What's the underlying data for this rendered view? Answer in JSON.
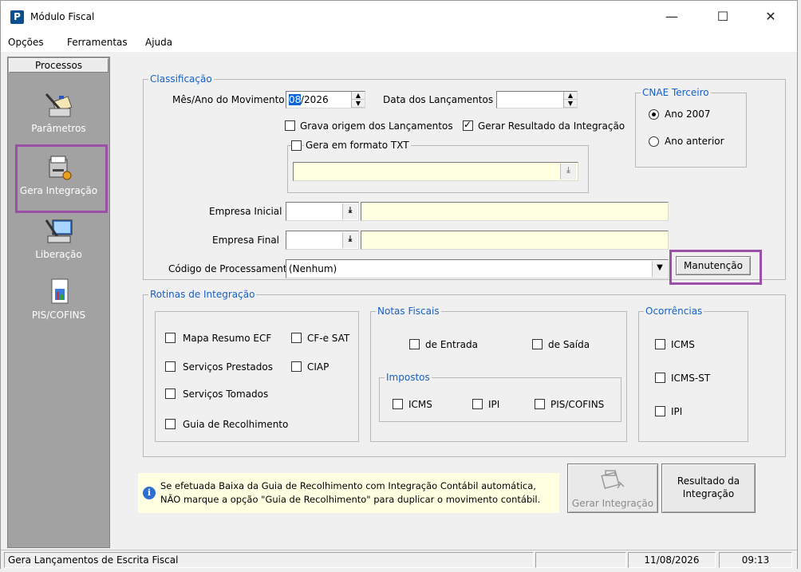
{
  "window": {
    "title": "Módulo Fiscal",
    "icon_letter": "P",
    "minimize_glyph": "—",
    "maximize_glyph": "☐",
    "close_glyph": "✕"
  },
  "menu": [
    "Opções",
    "Ferramentas",
    "Ajuda"
  ],
  "sidebar": {
    "header": "Processos",
    "items": [
      {
        "label": "Parâmetros",
        "icon": "parameters-icon"
      },
      {
        "label": "Gera Integração",
        "icon": "integration-icon",
        "highlighted": true
      },
      {
        "label": "Liberação",
        "icon": "release-icon"
      },
      {
        "label": "PIS/COFINS",
        "icon": "pis-cofins-icon"
      }
    ]
  },
  "classificacao": {
    "title": "Classificação",
    "mes_ano_label": "Mês/Ano do Movimento",
    "mes_ano_month": "08",
    "mes_ano_rest": "/2026",
    "data_lanc_label": "Data dos Lançamentos",
    "data_lanc_value": "",
    "grava_origem_label": "Grava origem dos Lançamentos",
    "grava_origem_checked": false,
    "gerar_resultado_label": "Gerar Resultado da Integração",
    "gerar_resultado_checked": true,
    "gera_txt_label": "Gera em formato TXT",
    "gera_txt_checked": false,
    "txt_path_value": "",
    "empresa_inicial_label": "Empresa Inicial",
    "empresa_inicial_code": "",
    "empresa_inicial_name": "",
    "empresa_final_label": "Empresa Final",
    "empresa_final_code": "",
    "empresa_final_name": "",
    "codigo_label": "Código de Processamento",
    "codigo_value": "(Nenhum)",
    "manutencao_label": "Manutenção"
  },
  "cnae": {
    "title": "CNAE Terceiro",
    "options": [
      {
        "label": "Ano 2007",
        "selected": true
      },
      {
        "label": "Ano anterior",
        "selected": false
      }
    ]
  },
  "rotinas": {
    "title": "Rotinas de Integração",
    "items": [
      {
        "label": "Mapa Resumo ECF",
        "checked": false
      },
      {
        "label": "CF-e SAT",
        "checked": false
      },
      {
        "label": "Serviços Prestados",
        "checked": false
      },
      {
        "label": "CIAP",
        "checked": false
      },
      {
        "label": "Serviços Tomados",
        "checked": false
      },
      {
        "label": "Guia de Recolhimento",
        "checked": false
      }
    ]
  },
  "notas": {
    "title": "Notas Fiscais",
    "entrada": "de Entrada",
    "saida": "de Saída"
  },
  "impostos": {
    "title": "Impostos",
    "items": [
      "ICMS",
      "IPI",
      "PIS/COFINS"
    ]
  },
  "ocorrencias": {
    "title": "Ocorrências",
    "items": [
      "ICMS",
      "ICMS-ST",
      "IPI"
    ]
  },
  "info": {
    "line1": "Se efetuada Baixa da Guia de Recolhimento com Integração Contábil automática,",
    "line2": "NÃO marque a opção \"Guia de Recolhimento\" para duplicar o movimento contábil."
  },
  "buttons": {
    "gerar": "Gerar Integração",
    "resultado_line1": "Resultado da",
    "resultado_line2": "Integração"
  },
  "status": {
    "message": "Gera Lançamentos de Escrita Fiscal",
    "date": "11/08/2026",
    "time": "09:13"
  },
  "colors": {
    "group_title": "#1660c7",
    "highlight": "#9b4fa8",
    "sidebar_bg": "#a2a2a2",
    "yellow_field": "#ffffe1"
  }
}
